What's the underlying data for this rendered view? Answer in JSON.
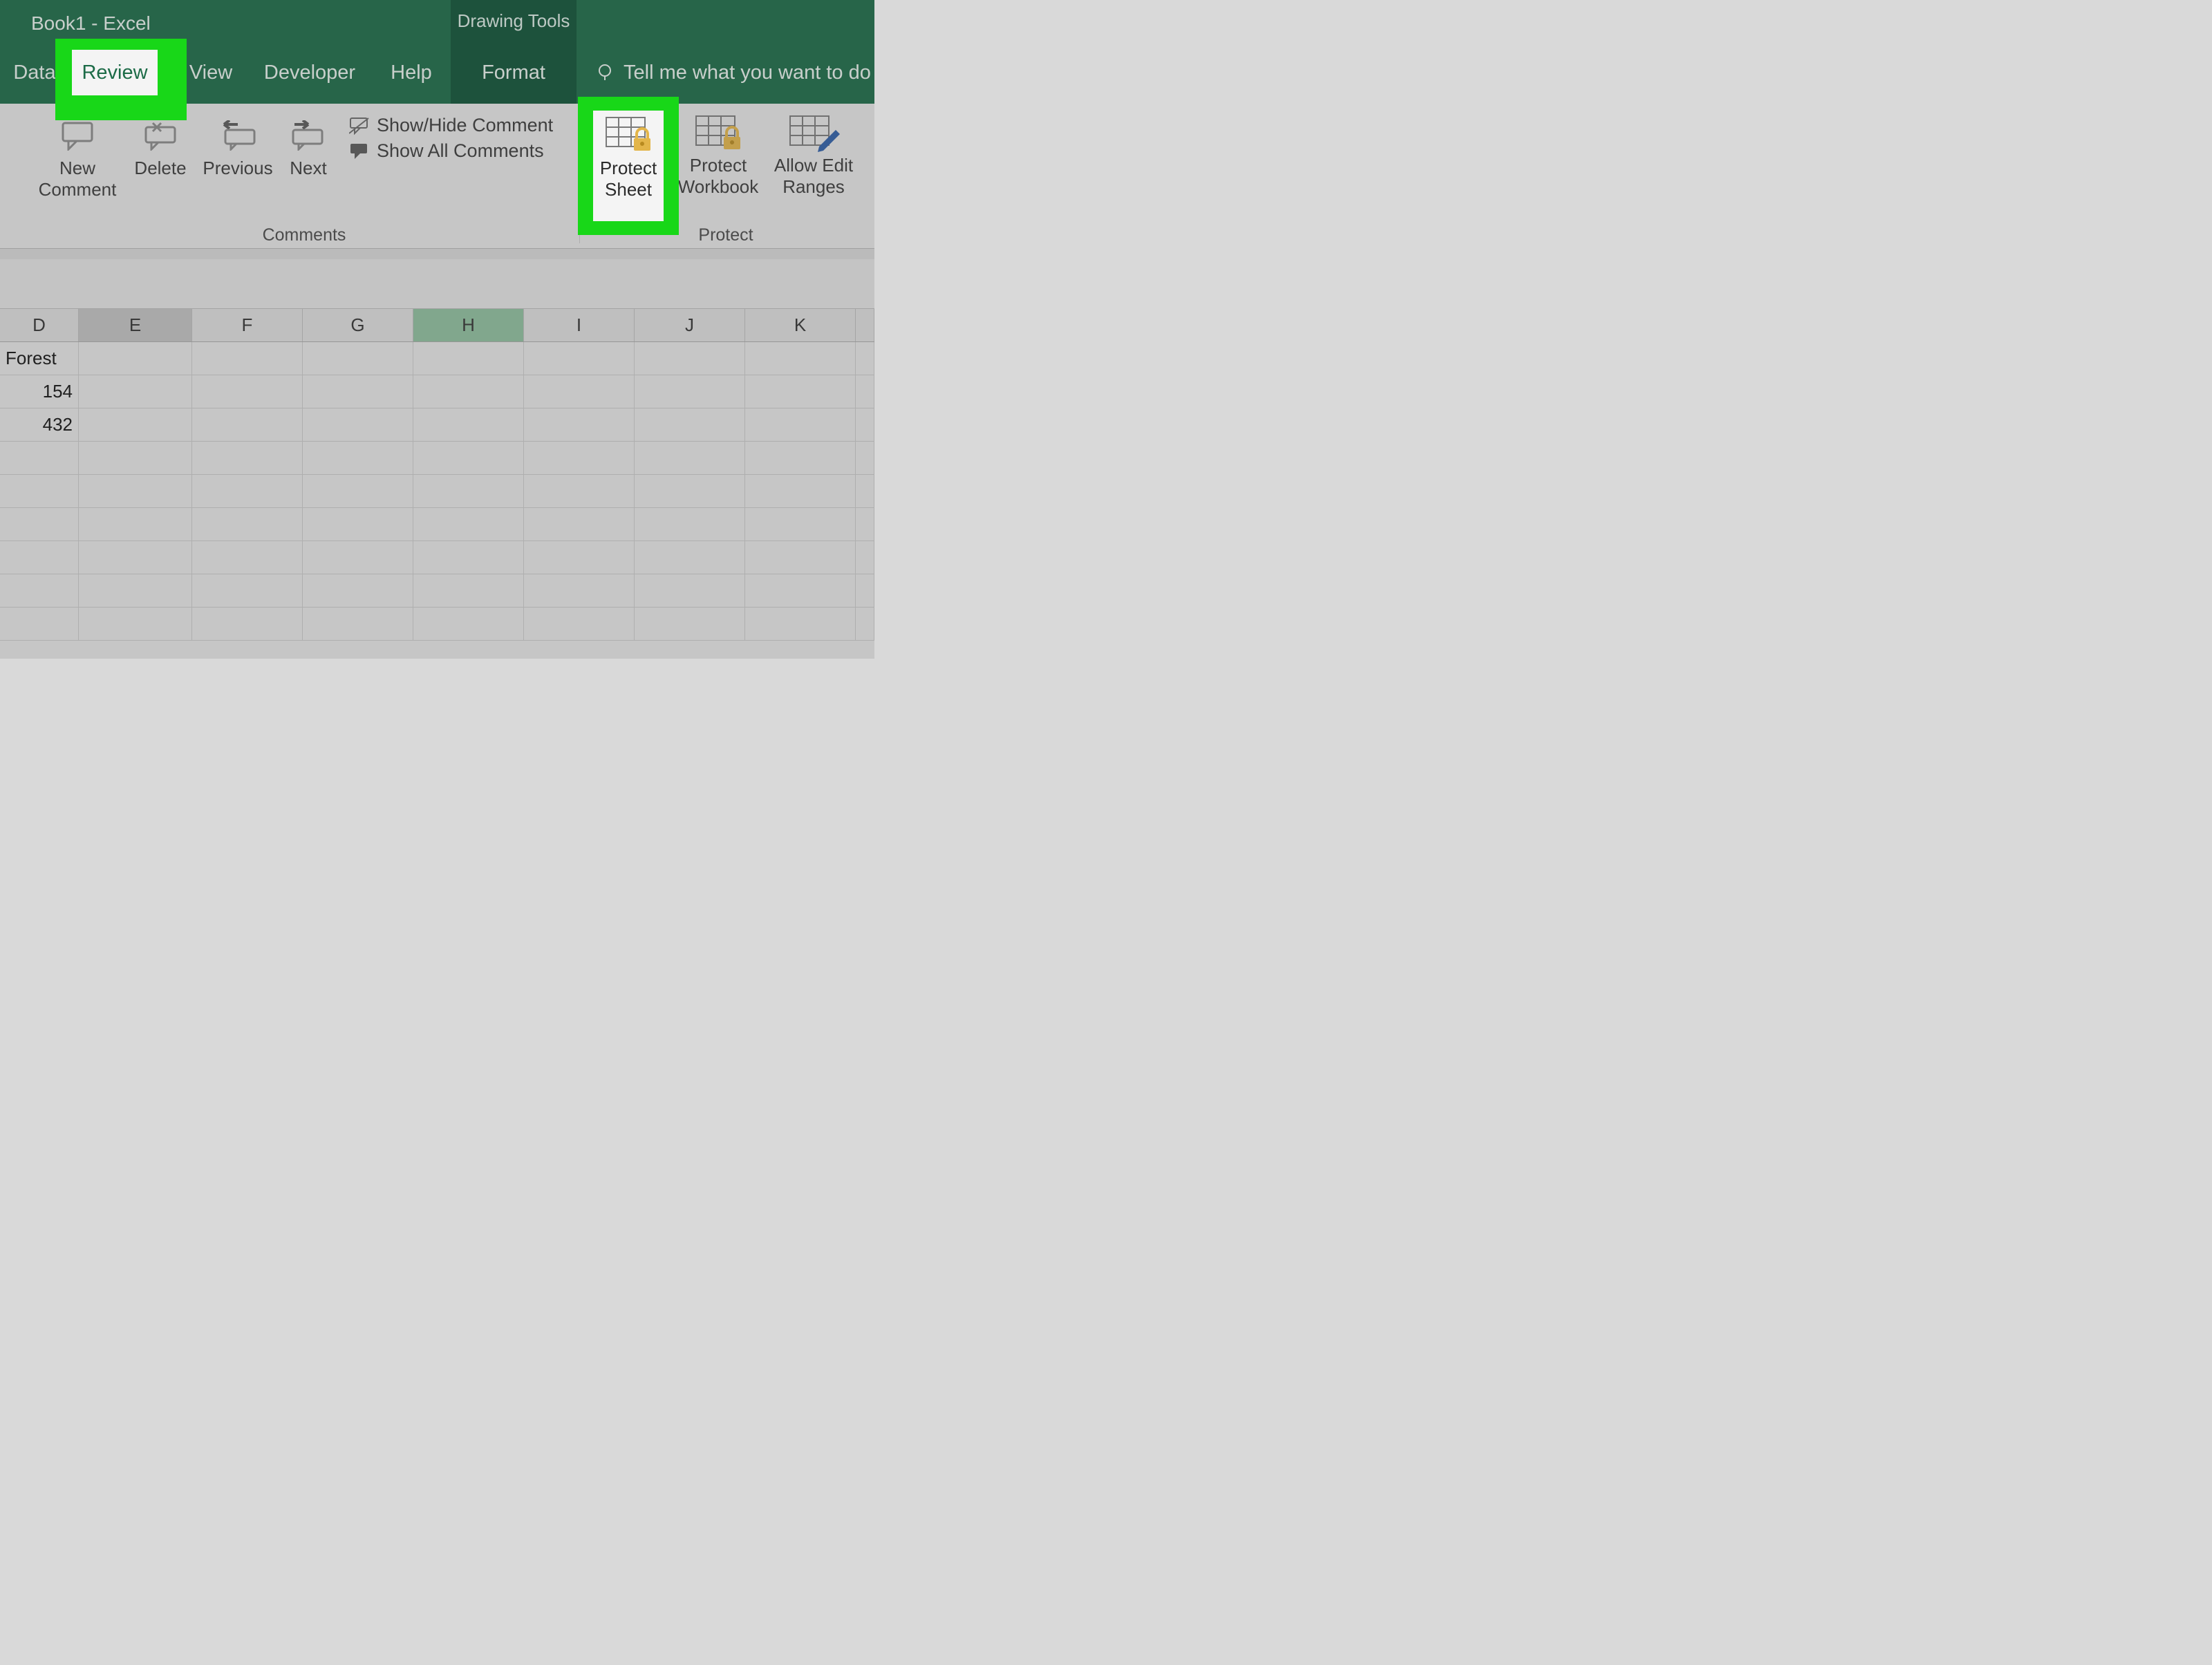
{
  "title": "Book1  -  Excel",
  "contextTab": "Drawing Tools",
  "tabs": {
    "data": "Data",
    "review": "Review",
    "view": "View",
    "developer": "Developer",
    "help": "Help",
    "format": "Format",
    "tellMe": "Tell me what you want to do"
  },
  "ribbon": {
    "newComment": {
      "l1": "New",
      "l2": "Comment"
    },
    "delete": "Delete",
    "previous": "Previous",
    "next": "Next",
    "showHideComment": "Show/Hide Comment",
    "showAllComments": "Show All Comments",
    "protectSheet": {
      "l1": "Protect",
      "l2": "Sheet"
    },
    "protectWorkbook": {
      "l1": "Protect",
      "l2": "Workbook"
    },
    "allowEditRanges": {
      "l1": "Allow Edit",
      "l2": "Ranges"
    },
    "groupComments": "Comments",
    "groupProtect": "Protect"
  },
  "columns": [
    "D",
    "E",
    "F",
    "G",
    "H",
    "I",
    "J",
    "K"
  ],
  "colState": {
    "selected": "E",
    "highlighted": "H"
  },
  "cells": {
    "D1": "Forest",
    "D2": "154",
    "D3": "432"
  }
}
